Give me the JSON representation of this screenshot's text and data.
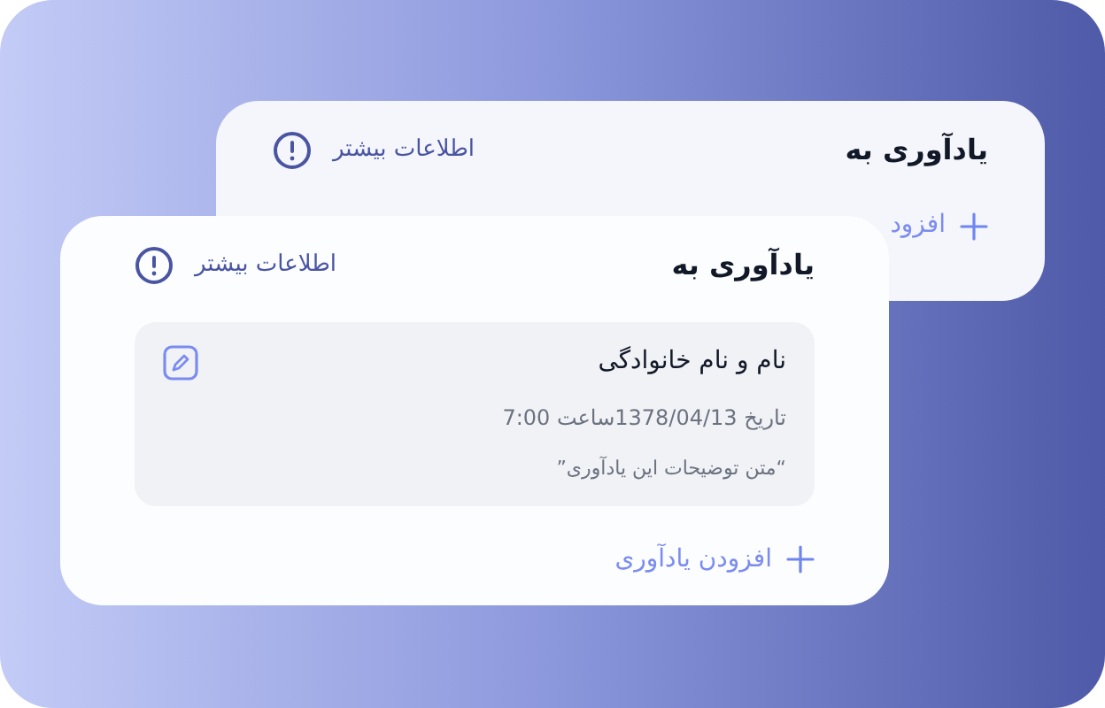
{
  "back_card": {
    "title": "یادآوری به",
    "info_link": "اطلاعات بیشتر",
    "add_button": "افزود"
  },
  "front_card": {
    "title": "یادآوری به",
    "info_link": "اطلاعات بیشتر",
    "reminders": [
      {
        "name": "نام و نام خانوادگی",
        "datetime": "تاریخ 1378/04/13ساعت 7:00",
        "description": "“متن توضیحات این یادآوری”"
      }
    ],
    "add_button": "افزودن یادآوری"
  }
}
